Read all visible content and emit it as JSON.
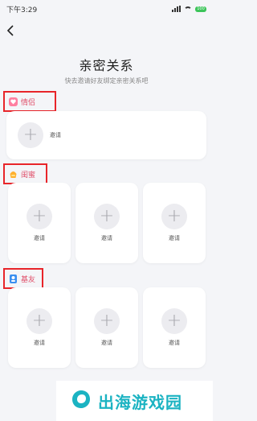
{
  "status": {
    "time": "下午3:29",
    "battery": "100"
  },
  "header": {
    "title": "亲密关系",
    "subtitle": "快去邀请好友绑定亲密关系吧"
  },
  "sections": [
    {
      "label": "情侣",
      "invite": [
        "邀请"
      ]
    },
    {
      "label": "闺蜜",
      "invite": [
        "邀请",
        "邀请",
        "邀请"
      ]
    },
    {
      "label": "基友",
      "invite": [
        "邀请",
        "邀请",
        "邀请"
      ]
    }
  ],
  "watermark": {
    "text": "出海游戏园"
  },
  "colors": {
    "accent": "#e0506a",
    "highlight_box": "#e8252a",
    "banner_text": "#1bb3c2"
  },
  "icons": {
    "back": "chevron-left-icon",
    "couple": "heart-icon",
    "bestie": "handbag-icon",
    "buddy": "person-icon",
    "add": "plus-icon"
  }
}
